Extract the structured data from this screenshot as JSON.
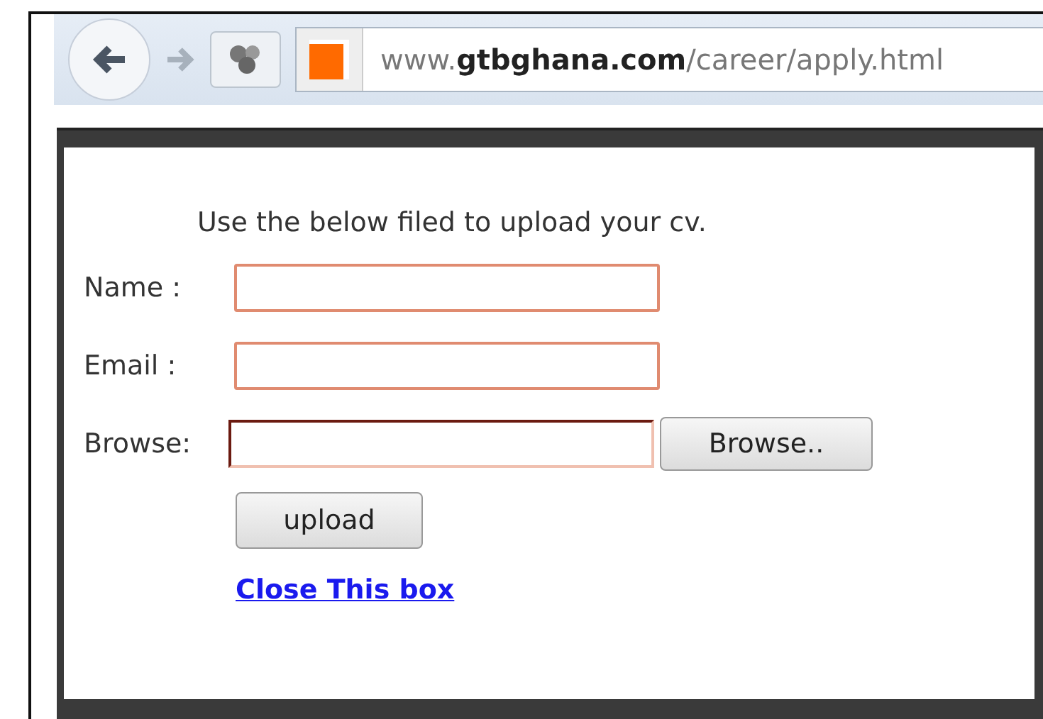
{
  "browser": {
    "url": "www.**gtbghana.com**/career/apply.html"
  },
  "form": {
    "heading": "Use the below filed to upload your cv.",
    "fields": [
      {
        "kind": "text",
        "label": "Name :"
      },
      {
        "kind": "text",
        "label": "Email :"
      },
      {
        "kind": "file",
        "label": "Browse:",
        "button": "Browse.."
      }
    ],
    "submit": "upload",
    "link": "Close This box"
  }
}
